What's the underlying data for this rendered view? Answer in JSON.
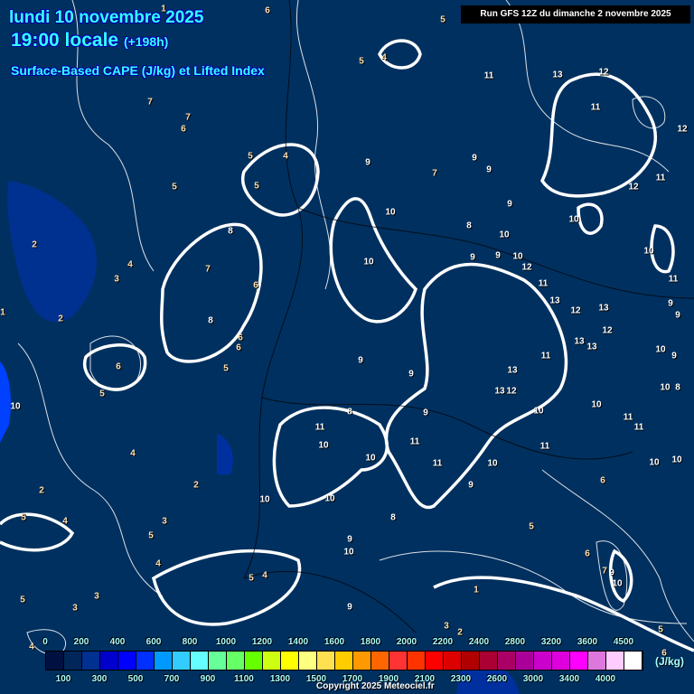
{
  "header": {
    "date": "lundi 10 novembre 2025",
    "time": "19:00 locale",
    "offset": "(+198h)",
    "parameter": "Surface-Based CAPE (J/kg) et Lifted Index",
    "run": "Run GFS 12Z du dimanche 2 novembre 2025"
  },
  "legend": {
    "unit": "(J/kg)",
    "labels": [
      "0",
      "100",
      "200",
      "300",
      "400",
      "500",
      "600",
      "700",
      "800",
      "900",
      "1000",
      "1100",
      "1200",
      "1300",
      "1400",
      "1500",
      "1600",
      "1700",
      "1800",
      "1900",
      "2000",
      "2100",
      "2200",
      "2300",
      "2400",
      "2600",
      "2800",
      "3000",
      "3200",
      "3400",
      "3600",
      "4000",
      "4500"
    ],
    "colors": [
      "#001040",
      "#00265a",
      "#003090",
      "#0000cc",
      "#0000ff",
      "#0030ff",
      "#0099ff",
      "#33ccff",
      "#66ffff",
      "#66ff99",
      "#66ff66",
      "#66ff00",
      "#ccff11",
      "#ffff00",
      "#ffff80",
      "#ffe050",
      "#ffcc00",
      "#ff9900",
      "#ff6600",
      "#ff3333",
      "#ff3300",
      "#ff0000",
      "#dd0000",
      "#b00000",
      "#aa0033",
      "#aa0066",
      "#aa0099",
      "#cc00cc",
      "#dd00dd",
      "#ff00ff",
      "#dd77dd",
      "#ffccff",
      "#ffffff"
    ]
  },
  "copyright": "Copyright 2025 Meteociel.fr",
  "colors": {
    "background": "#00305f",
    "cape_low": "#003090",
    "cape_mid": "#0000ff",
    "contour": "#ffffff",
    "title": "#33ffff"
  },
  "contour_labels": [
    "1",
    "6",
    "5",
    "5",
    "4",
    "11",
    "13",
    "12",
    "11",
    "12",
    "7",
    "7",
    "6",
    "5",
    "4",
    "5",
    "5",
    "9",
    "7",
    "9",
    "9",
    "9",
    "12",
    "11",
    "10",
    "8",
    "10",
    "10",
    "8",
    "2",
    "9",
    "9",
    "10",
    "12",
    "10",
    "7",
    "4",
    "3",
    "10",
    "6",
    "11",
    "11",
    "13",
    "12",
    "13",
    "9",
    "9",
    "1",
    "2",
    "8",
    "6",
    "6",
    "13",
    "13",
    "12",
    "10",
    "9",
    "6",
    "5",
    "9",
    "9",
    "11",
    "13",
    "13",
    "12",
    "5",
    "10",
    "9",
    "8",
    "10",
    "10",
    "10",
    "8",
    "11",
    "11",
    "11",
    "10",
    "11",
    "11",
    "4",
    "10",
    "11",
    "10",
    "10",
    "10",
    "2",
    "9",
    "6",
    "2",
    "10",
    "10",
    "5",
    "4",
    "3",
    "8",
    "5",
    "5",
    "9",
    "10",
    "6",
    "4",
    "5",
    "4",
    "7",
    "9",
    "10",
    "3",
    "1",
    "5",
    "3",
    "9",
    "3",
    "2",
    "5",
    "4",
    "6"
  ]
}
